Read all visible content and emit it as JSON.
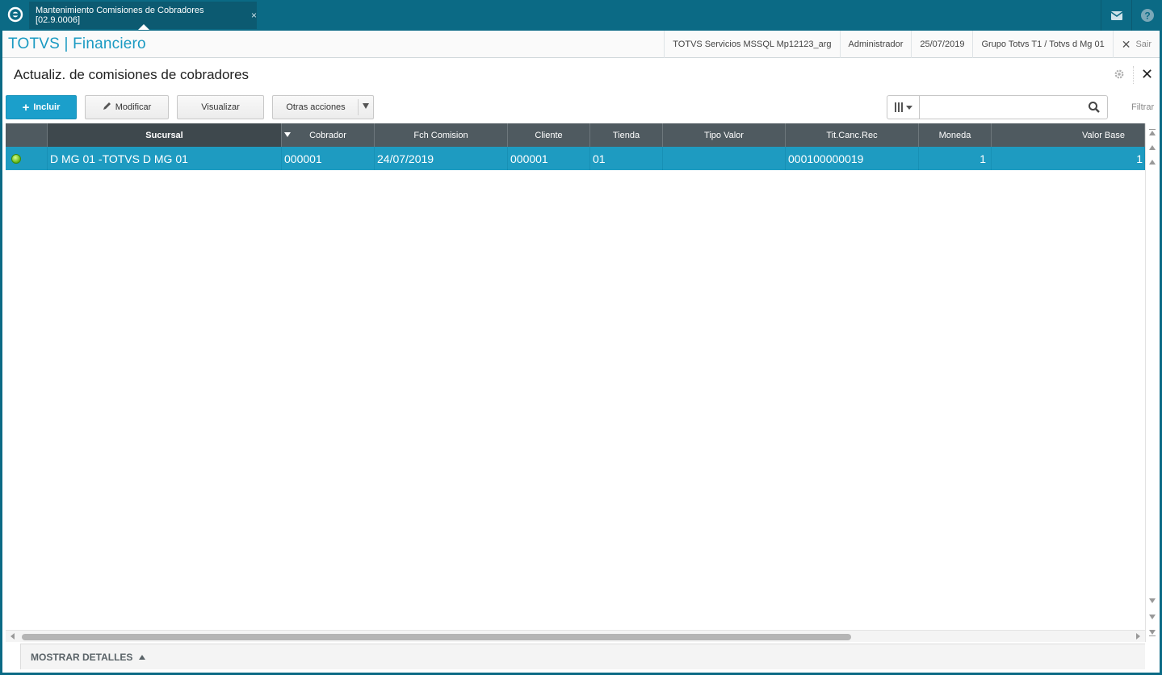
{
  "app": {
    "tab_title": "Mantenimiento Comisiones de Cobradores [02.9.0006]",
    "tab_close": "×"
  },
  "header": {
    "brand": "TOTVS | Financiero",
    "server": "TOTVS Servicios MSSQL Mp12123_arg",
    "user": "Administrador",
    "date": "25/07/2019",
    "company": "Grupo Totvs T1 / Totvs d Mg 01",
    "exit_label": "Sair"
  },
  "page": {
    "title": "Actualiz. de comisiones de cobradores"
  },
  "toolbar": {
    "include_label": "Incluir",
    "modify_label": "Modificar",
    "view_label": "Visualizar",
    "other_label": "Otras acciones"
  },
  "search": {
    "value": "",
    "placeholder": "",
    "filter_label": "Filtrar"
  },
  "grid": {
    "columns": [
      "",
      "Sucursal",
      "Cobrador",
      "Fch Comision",
      "Cliente",
      "Tienda",
      "Tipo Valor",
      "Tit.Canc.Rec",
      "Moneda",
      "Valor Base"
    ],
    "sorted_column": "Sucursal",
    "rows": [
      {
        "status": "green",
        "sucursal": "D MG 01 -TOTVS D MG 01",
        "cobrador": "000001",
        "fch_comision": "24/07/2019",
        "cliente": "000001",
        "tienda": "01",
        "tipo_valor": "",
        "tit_canc_rec": "000100000019",
        "moneda": "1",
        "valor_base": "1"
      }
    ]
  },
  "footer": {
    "details_label": "MOSTRAR DETALLES"
  },
  "colors": {
    "topbar": "#0b6a85",
    "brand": "#1a9ac2",
    "primary_button": "#1b9fcb",
    "grid_header": "#4f5a60",
    "selected_row": "#1e9bc1",
    "status_ok": "#5fb315"
  },
  "icons": {
    "logo": "totvs-logo-icon",
    "mail": "mail-icon",
    "help": "help-icon",
    "gear": "gear-icon",
    "close": "close-icon",
    "search": "search-icon",
    "columns": "columns-icon",
    "pencil": "pencil-icon"
  }
}
